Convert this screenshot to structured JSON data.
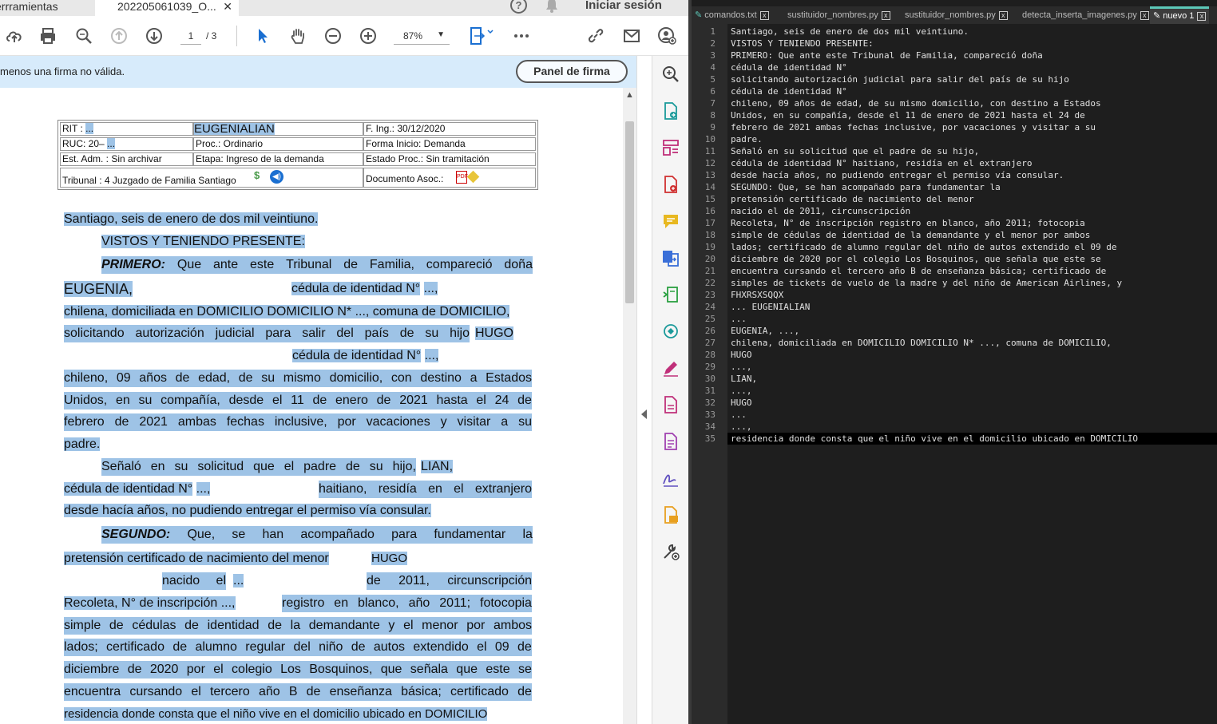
{
  "pdf": {
    "tab_tools": "errramientas",
    "tab_doc": "202205061039_O...",
    "signin": "Iniciar sesión",
    "page_current": "1",
    "page_total": "/ 3",
    "zoom": "87%",
    "sig_message": "menos una firma no válida.",
    "sig_button": "Panel de firma",
    "info": {
      "rit_label": "RIT :",
      "rit_value": "...",
      "name": "EUGENIALIAN",
      "fing": "F. Ing.: 30/12/2020",
      "ruc_label": "RUC: 20–",
      "ruc_value": "...",
      "proc": "Proc.: Ordinario",
      "forma": "Forma Inicio: Demanda",
      "estadm": "Est. Adm. : Sin archivar",
      "etapa": "Etapa: Ingreso de la demanda",
      "estproc": "Estado Proc.: Sin tramitación",
      "tribunal": "Tribunal : 4 Juzgado de Familia Santiago",
      "docasoc": "Documento Asoc.:"
    },
    "doc": {
      "l1": "Santiago, seis de enero de dos mil veintiuno.",
      "l2": "VISTOS Y TENIENDO PRESENTE:",
      "l3_bold": "PRIMERO:",
      "l3": [
        "Que",
        "ante",
        "este",
        "Tribunal",
        "de",
        "Familia,",
        "compareció",
        "doña"
      ],
      "l4_name": "EUGENIA,",
      "l4_ced": "cédula de identidad N°",
      "l4_val": "...,",
      "l5": "chilena, domiciliada en DOMICILIO DOMICILIO N* ..., comuna de DOMICILIO,",
      "l6": [
        "solicitando",
        "autorización",
        "judicial",
        "para",
        "salir",
        "del",
        "país",
        "de",
        "su",
        "hijo"
      ],
      "l6_name": "HUGO",
      "l7_ced": "cédula de identidad N°",
      "l7_val": "...,",
      "l8": [
        "chileno,",
        "09",
        "años",
        "de",
        "edad,",
        "de",
        "su",
        "mismo",
        "domicilio,",
        "con",
        "destino",
        "a",
        "Estados"
      ],
      "l9": [
        "Unidos,",
        "en",
        "su",
        "compañía,",
        "desde",
        "el",
        "11",
        "de",
        "enero",
        "de",
        "2021",
        "hasta",
        "el",
        "24",
        "de"
      ],
      "l10": [
        "febrero",
        "de",
        "2021",
        "ambas",
        "fechas",
        "inclusive,",
        "por",
        "vacaciones",
        "y",
        "visitar",
        "a",
        "su"
      ],
      "l11": "padre.",
      "l12": [
        "Señaló",
        "en",
        "su",
        "solicitud",
        "que",
        "el",
        "padre",
        "de",
        "su",
        "hijo,"
      ],
      "l12_name": "LIAN,",
      "l13a": "cédula de identidad N°",
      "l13v": "...,",
      "l13b": [
        "haitiano,",
        "residía",
        "en",
        "el",
        "extranjero"
      ],
      "l14": "desde hacía años, no pudiendo entregar el permiso vía consular.",
      "l15_bold": "SEGUNDO:",
      "l15": [
        "Que,",
        "se",
        "han",
        "acompañado",
        "para",
        "fundamentar",
        "la"
      ],
      "l16": "pretensión certificado de nacimiento del menor",
      "l16_name": "HUGO",
      "l17a": [
        "nacido",
        "el"
      ],
      "l17v": "...",
      "l17b": [
        "de",
        "2011,",
        "circunscripción"
      ],
      "l18a": "Recoleta, N° de inscripción ...,",
      "l18b": [
        "registro",
        "en",
        "blanco,",
        "año",
        "2011;",
        "fotocopia"
      ],
      "l19": [
        "simple",
        "de",
        "cédulas",
        "de",
        "identidad",
        "de",
        "la",
        "demandante",
        "y",
        "el",
        "menor",
        "por",
        "ambos"
      ],
      "l20": [
        "lados;",
        "certificado",
        "de",
        "alumno",
        "regular",
        "del",
        "niño",
        "de",
        "autos",
        "extendido",
        "el",
        "09",
        "de"
      ],
      "l21": [
        "diciembre",
        "de",
        "2020",
        "por",
        "el",
        "colegio",
        "Los",
        "Bosquinos,",
        "que",
        "señala",
        "que",
        "este",
        "se"
      ],
      "l22": [
        "encuentra",
        "cursando",
        "el",
        "tercero",
        "año",
        "B",
        "de",
        "enseñanza",
        "básica;",
        "certificado",
        "de"
      ],
      "l23": "residencia donde consta que el niño vive en el domicilio ubicado en DOMICILIO"
    }
  },
  "notepad": {
    "tabs": [
      "comandos.txt",
      "sustituidor_nombres.py",
      "sustituidor_nombres.py",
      "detecta_inserta_imagenes.py",
      "nuevo 1"
    ],
    "lines": [
      "Santiago, seis de enero de dos mil veintiuno.",
      "VISTOS Y TENIENDO PRESENTE:",
      "PRIMERO: Que ante este Tribunal de Familia, compareció doña",
      "cédula de identidad N°",
      "solicitando autorización judicial para salir del país de su hijo",
      "cédula de identidad N°",
      "chileno, 09 años de edad, de su mismo domicilio, con destino a Estados",
      "Unidos, en su compañía, desde el 11 de enero de 2021 hasta el 24 de",
      "febrero de 2021 ambas fechas inclusive, por vacaciones y visitar a su",
      "padre.",
      "Señaló en su solicitud que el padre de su hijo,",
      "cédula de identidad N° haitiano, residía en el extranjero",
      "desde hacía años, no pudiendo entregar el permiso vía consular.",
      "SEGUNDO: Que, se han acompañado para fundamentar la",
      "pretensión certificado de nacimiento del menor",
      "nacido el de 2011, circunscripción",
      "Recoleta, N° de inscripción registro en blanco, año 2011; fotocopia",
      "simple de cédulas de identidad de la demandante y el menor por ambos",
      "lados; certificado de alumno regular del niño de autos extendido el 09 de",
      "diciembre de 2020 por el colegio Los Bosquinos, que señala que este se",
      "encuentra cursando el tercero año B de enseñanza básica; certificado de",
      "simples de tickets de vuelo de la madre y del niño de American Airlines, y",
      "FHXRSXSQQX",
      "... EUGENIALIAN",
      "...",
      "EUGENIA, ...,",
      "chilena, domiciliada en DOMICILIO DOMICILIO N* ..., comuna de DOMICILIO,",
      "HUGO",
      "...,",
      "LIAN,",
      "...,",
      "HUGO",
      "...",
      "...,",
      "residencia donde consta que el niño vive en el domicilio ubicado en DOMICILIO"
    ]
  }
}
